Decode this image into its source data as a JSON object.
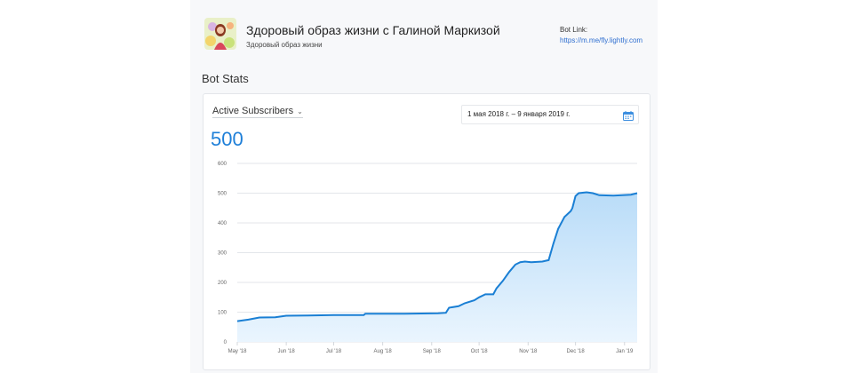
{
  "header": {
    "bot_name": "Здоровый образ жизни с Галиной Маркизой",
    "bot_subtitle": "Здоровый образ жизни",
    "bot_link_label": "Bot Link:",
    "bot_link": "https://m.me/fly.lightly.com"
  },
  "stats": {
    "section_title": "Bot Stats",
    "metric_label": "Active Subscribers",
    "metric_chevron": "⌄",
    "date_range": "1 мая 2018 г. – 9 января 2019 г.",
    "current_value": "500"
  },
  "colors": {
    "accent": "#1e7fd8",
    "line": "#1a7fd4",
    "fill_top": "#b9dcf8",
    "fill_bottom": "#eaf5fe"
  },
  "chart_data": {
    "type": "area",
    "title": "",
    "xlabel": "",
    "ylabel": "",
    "ylim": [
      0,
      600
    ],
    "yticks": [
      0,
      100,
      200,
      300,
      400,
      500,
      600
    ],
    "xlim": [
      "2018-05-01",
      "2019-01-09"
    ],
    "xticks": [
      {
        "date": "2018-05-01",
        "label": "May '18"
      },
      {
        "date": "2018-06-01",
        "label": "Jun '18"
      },
      {
        "date": "2018-07-01",
        "label": "Jul '18"
      },
      {
        "date": "2018-08-01",
        "label": "Aug '18"
      },
      {
        "date": "2018-09-01",
        "label": "Sep '18"
      },
      {
        "date": "2018-10-01",
        "label": "Oct '18"
      },
      {
        "date": "2018-11-01",
        "label": "Nov '18"
      },
      {
        "date": "2018-12-01",
        "label": "Dec '18"
      },
      {
        "date": "2019-01-01",
        "label": "Jan '19"
      }
    ],
    "grid": true,
    "series": [
      {
        "points": [
          [
            "2018-05-01",
            70
          ],
          [
            "2018-05-08",
            75
          ],
          [
            "2018-05-15",
            82
          ],
          [
            "2018-05-25",
            83
          ],
          [
            "2018-06-01",
            88
          ],
          [
            "2018-06-15",
            89
          ],
          [
            "2018-07-01",
            90
          ],
          [
            "2018-07-20",
            90
          ],
          [
            "2018-07-21",
            95
          ],
          [
            "2018-08-15",
            95
          ],
          [
            "2018-09-05",
            96
          ],
          [
            "2018-09-10",
            98
          ],
          [
            "2018-09-12",
            115
          ],
          [
            "2018-09-18",
            120
          ],
          [
            "2018-09-22",
            130
          ],
          [
            "2018-09-28",
            140
          ],
          [
            "2018-10-01",
            150
          ],
          [
            "2018-10-05",
            160
          ],
          [
            "2018-10-10",
            160
          ],
          [
            "2018-10-12",
            180
          ],
          [
            "2018-10-16",
            205
          ],
          [
            "2018-10-20",
            235
          ],
          [
            "2018-10-24",
            260
          ],
          [
            "2018-10-27",
            268
          ],
          [
            "2018-10-30",
            270
          ],
          [
            "2018-11-03",
            268
          ],
          [
            "2018-11-10",
            270
          ],
          [
            "2018-11-14",
            275
          ],
          [
            "2018-11-17",
            330
          ],
          [
            "2018-11-20",
            380
          ],
          [
            "2018-11-24",
            420
          ],
          [
            "2018-11-28",
            440
          ],
          [
            "2018-11-29",
            450
          ],
          [
            "2018-12-01",
            490
          ],
          [
            "2018-12-03",
            500
          ],
          [
            "2018-12-08",
            503
          ],
          [
            "2018-12-12",
            500
          ],
          [
            "2018-12-16",
            493
          ],
          [
            "2018-12-25",
            492
          ],
          [
            "2019-01-05",
            495
          ],
          [
            "2019-01-09",
            500
          ]
        ]
      }
    ]
  }
}
